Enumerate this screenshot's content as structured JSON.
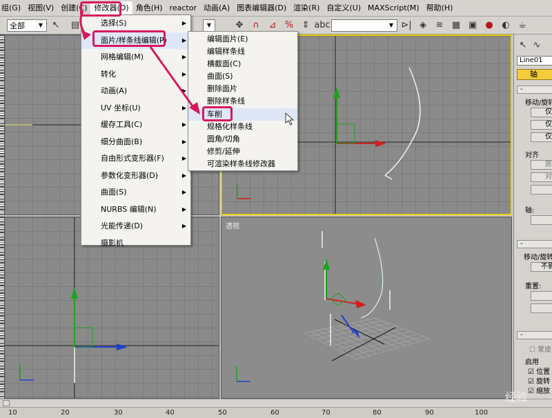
{
  "menubar": {
    "items": [
      "组(G)",
      "视图(V)",
      "创建(C)",
      "修改器(O)",
      "角色(H)",
      "reactor",
      "动画(A)",
      "图表编辑器(D)",
      "渲染(R)",
      "自定义(U)",
      "MAXScript(M)",
      "帮助(H)"
    ]
  },
  "toolbar": {
    "selection_filter": "全部"
  },
  "viewports": {
    "perspective_label": "透视"
  },
  "modifier_menu": {
    "items": [
      "选择(S)",
      "面片/样条线编辑(P)",
      "网格编辑(M)",
      "转化",
      "动画(A)",
      "UV 坐标(U)",
      "缓存工具(C)",
      "细分曲面(B)",
      "自由形式变形器(F)",
      "参数化变形器(D)",
      "曲面(S)",
      "NURBS 编辑(N)",
      "光能传递(D)",
      "摄影机"
    ]
  },
  "spline_submenu": {
    "items": [
      "编辑面片(E)",
      "编辑样条线",
      "横截面(C)",
      "曲面(S)",
      "删除面片",
      "删除样条线",
      "车削",
      "规格化样条线",
      "圆角/切角",
      "修剪/延伸",
      "可渲染样条线修改器"
    ]
  },
  "command_panel": {
    "object_name": "Line01",
    "axis_tab": "轴",
    "move_rotate": "移动/旋转",
    "align": "对齐",
    "axis_label": "轴:",
    "move_rotate_2": "移动/旋转",
    "no_affect": "不影",
    "reset": "重置:",
    "skin": "蒙皮",
    "enable": "启用",
    "position": "位置",
    "rotate": "旋转",
    "scale": "缩放",
    "btn_a": "仅",
    "btn_b": "仅",
    "btn_c": "仅",
    "btn_d": "居",
    "btn_e": "对"
  },
  "timeline": {
    "ticks": [
      "10",
      "20",
      "30",
      "40",
      "50",
      "60",
      "70",
      "80",
      "90",
      "100"
    ]
  },
  "watermark": "经验",
  "colors": {
    "highlight_box": "#d9185e",
    "active_viewport_border": "#e8d200",
    "gizmo_y": "#1fa11f",
    "gizmo_x": "#d02020",
    "gizmo_z": "#1f3fd0"
  }
}
